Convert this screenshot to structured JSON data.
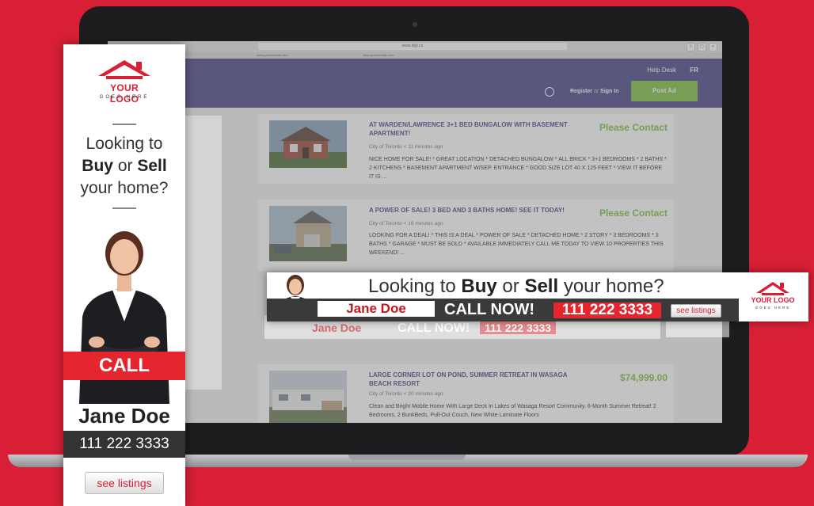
{
  "browser": {
    "url": "www.kijiji.ca",
    "tabs": [
      "www.yourwebsite.com",
      "www.yourwebsite.com"
    ]
  },
  "site_header": {
    "help_desk": "Help Desk",
    "language": "FR",
    "register_label": "Register",
    "or_label": "or",
    "signin_label": "Sign In",
    "post_ad_label": "Post Ad"
  },
  "listings": [
    {
      "title": "AT WARDEN/LAWRENCE 3+1 BED BUNGALOW WITH BASEMENT APARTMENT!",
      "city": "City of Toronto",
      "time": "< 11 minutes ago",
      "description": "NICE HOME FOR SALE! * GREAT LOCATION * DETACHED BUNGALOW * ALL BRICK * 3+1 BEDROOMS * 2 BATHS * 2 KITCHENS * BASEMENT APARTMENT W/SEP. ENTRANCE * GOOD SIZE LOT 40 X 125 FEET * VIEW IT BEFORE IT IS ...",
      "price": "Please Contact"
    },
    {
      "title": "A POWER OF SALE! 3 BED AND 3 BATHS HOME! SEE IT TODAY!",
      "city": "City of Toronto",
      "time": "< 16 minutes ago",
      "description": "LOOKING FOR A DEAL! * THIS IS A DEAL * POWER OF SALE * DETACHED HOME * 2 STORY * 3 BEDROOMS * 3 BATHS * GARAGE * MUST BE SOLD * AVAILABLE IMMEDIATELY CALL ME TODAY TO VIEW 10 PROPERTIES THIS WEEKEND! ...",
      "price": "Please Contact"
    },
    {
      "title": "LARGE CORNER LOT ON POND, SUMMER RETREAT IN WASAGA BEACH RESORT",
      "city": "City of Toronto",
      "time": "< 20 minutes ago",
      "description": "Clean and Bright Mobile Home With Large Deck In Lakes of Wasaga Resort Community. 6-Month Summer Retreat! 2 Bedrooms, 2 BunkBeds, Pull-Out Couch, New White Laminate Floors",
      "price": "$74,999.00"
    }
  ],
  "logo": {
    "line1": "YOUR LOGO",
    "line2": "GOES HERE"
  },
  "tower_ad": {
    "headline_1": "Looking to",
    "headline_buy": "Buy",
    "headline_or": " or ",
    "headline_sell": "Sell",
    "headline_3": "your home?",
    "call_label": "CALL",
    "agent_name": "Jane Doe",
    "phone": "111 222 3333",
    "see_listings_label": "see listings"
  },
  "banner_ad": {
    "headline_pre": "Looking to ",
    "headline_buy": "Buy",
    "headline_or": " or ",
    "headline_sell": "Sell",
    "headline_post": " your home?",
    "agent_name": "Jane Doe",
    "call_now_label": "CALL NOW!",
    "phone": "111 222 3333",
    "see_listings_label": "see listings"
  },
  "colors": {
    "background": "#d81f35",
    "header": "#4a4789",
    "post_ad": "#7cc142",
    "price": "#7cc142",
    "call_red": "#e5262e"
  }
}
